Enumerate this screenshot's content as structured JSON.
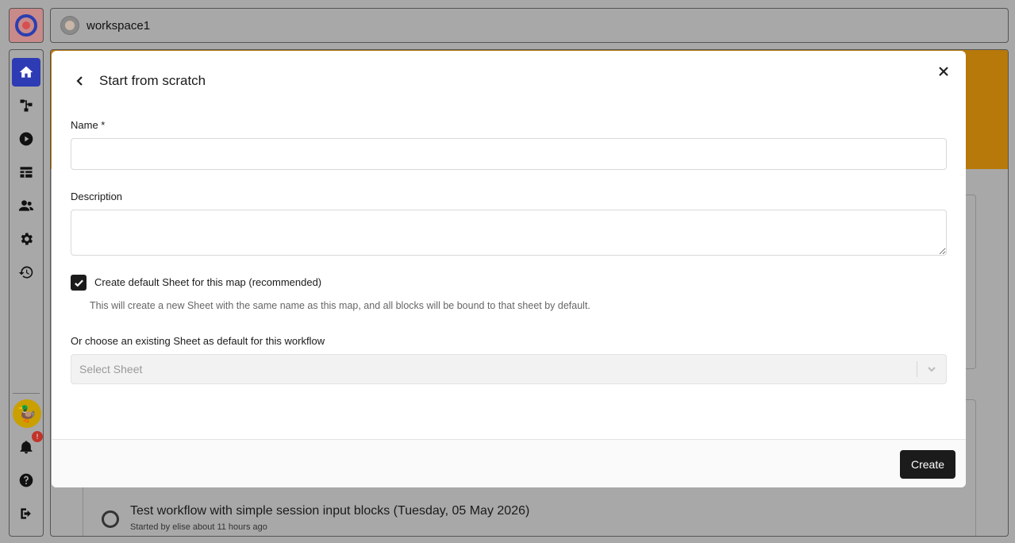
{
  "topbar": {
    "workspace_name": "workspace1"
  },
  "modal": {
    "title": "Start from scratch",
    "name_label": "Name *",
    "name_value": "",
    "description_label": "Description",
    "description_value": "",
    "create_default_sheet": {
      "checked": true,
      "label": "Create default Sheet for this map (recommended)",
      "hint": "This will create a new Sheet with the same name as this map, and all blocks will be bound to that sheet by default."
    },
    "existing_sheet_label": "Or choose an existing Sheet as default for this workflow",
    "select_placeholder": "Select Sheet",
    "create_button": "Create"
  },
  "background": {
    "run_title": "Test workflow with simple session input blocks (Tuesday, 05 May 2026)",
    "run_subtitle": "Started by elise about 11 hours ago"
  },
  "notifications": {
    "count": "!"
  },
  "colors": {
    "accent": "#2d3bb5",
    "banner": "#b8790b",
    "primary_button": "#1b1b1b"
  }
}
